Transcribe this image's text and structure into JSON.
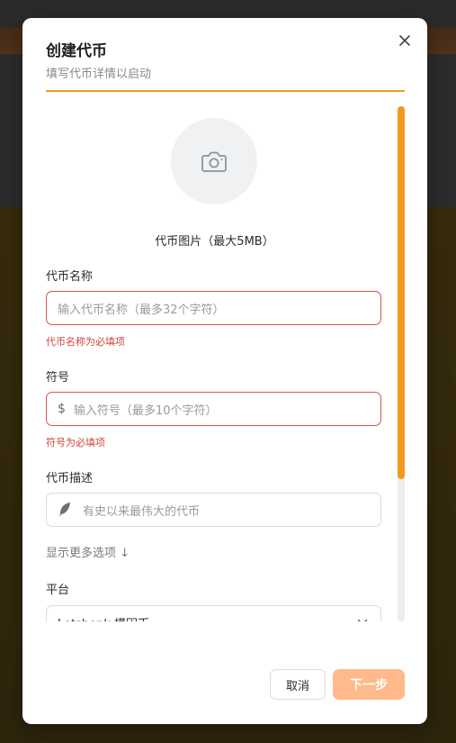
{
  "modal": {
    "title": "创建代币",
    "subtitle": "填写代币详情以启动"
  },
  "upload": {
    "label": "代币图片（最大5MB）"
  },
  "fields": {
    "name": {
      "label": "代币名称",
      "placeholder": "输入代币名称（最多32个字符）",
      "error": "代币名称为必填项"
    },
    "symbol": {
      "label": "符号",
      "prefix": "$",
      "placeholder": "输入符号（最多10个字符）",
      "error": "符号为必填项"
    },
    "description": {
      "label": "代币描述",
      "placeholder": "有史以来最伟大的代币"
    }
  },
  "more_options": "显示更多选项 ↓",
  "platform": {
    "label": "平台",
    "value": "Letsbonk 模因币"
  },
  "buttons": {
    "cancel": "取消",
    "next": "下一步"
  },
  "colors": {
    "accent": "#f29a1f",
    "error": "#d0463a",
    "next_button": "#ffb98a"
  }
}
